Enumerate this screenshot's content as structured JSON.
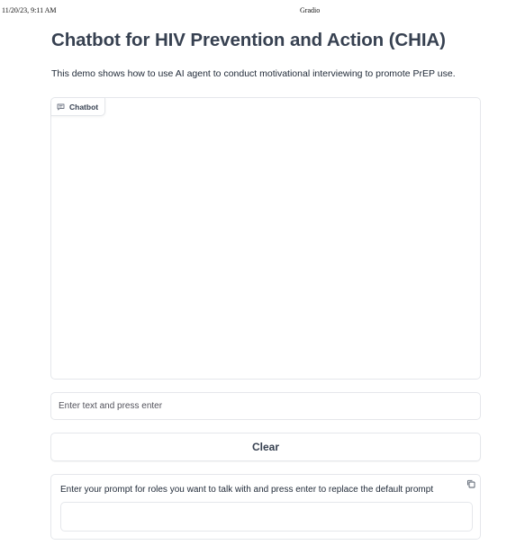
{
  "print_header": {
    "date": "11/20/23, 9:11 AM",
    "title": "Gradio"
  },
  "page": {
    "title": "Chatbot for HIV Prevention and Action (CHIA)",
    "description": "This demo shows how to use AI agent to conduct motivational interviewing to promote PrEP use."
  },
  "chatbot": {
    "label": "Chatbot",
    "label_icon": "chat-bubble-icon",
    "messages": []
  },
  "message_input": {
    "placeholder": "Enter text and press enter",
    "value": ""
  },
  "clear_button": {
    "label": "Clear"
  },
  "prompt_box": {
    "label": "Enter your prompt for roles you want to talk with and press enter to replace the default prompt",
    "copy_icon": "copy-icon",
    "value": ""
  }
}
